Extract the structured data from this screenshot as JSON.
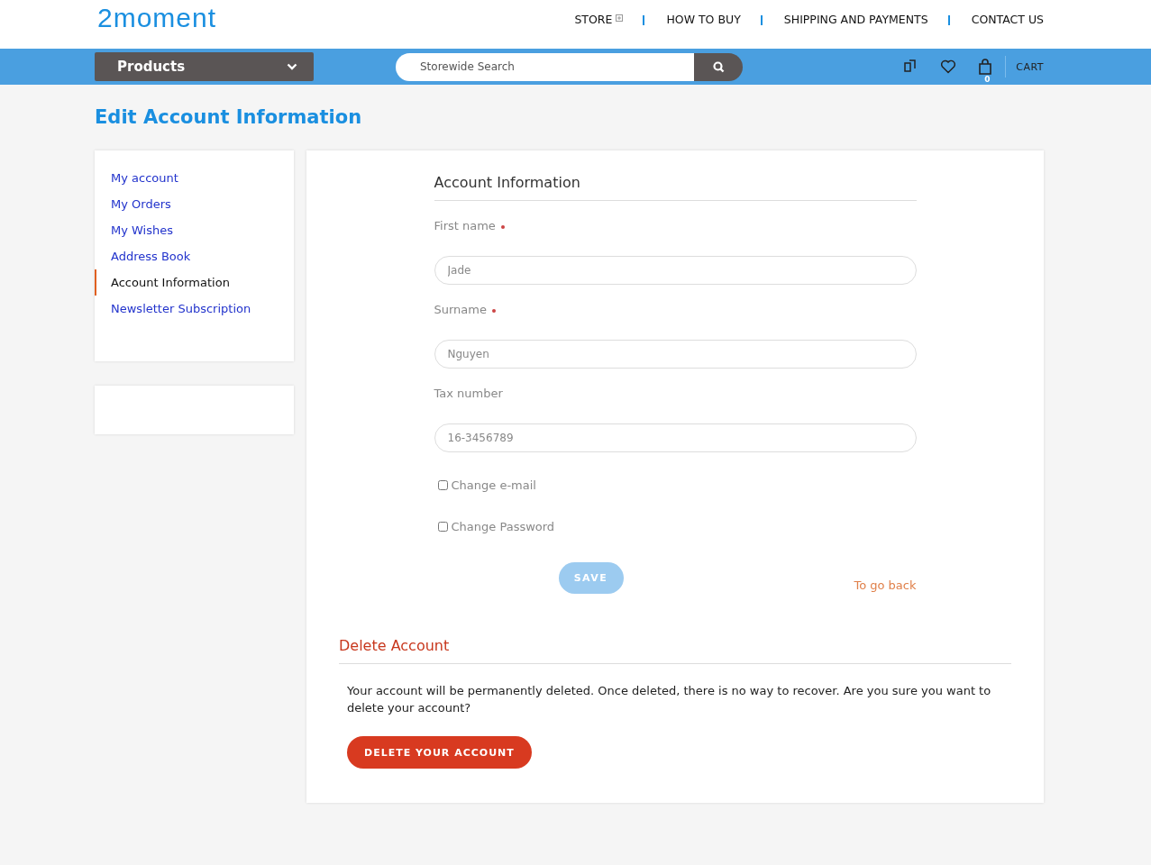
{
  "header": {
    "logo": "2moment",
    "nav": [
      {
        "label": "STORE",
        "has_menu": true
      },
      {
        "label": "HOW TO BUY",
        "has_menu": false
      },
      {
        "label": "SHIPPING AND PAYMENTS",
        "has_menu": false
      },
      {
        "label": "CONTACT US",
        "has_menu": false
      }
    ]
  },
  "toolbar": {
    "products_label": "Products",
    "search": {
      "placeholder": "Storewide Search"
    },
    "cart_count": "0",
    "cart_label": "CART"
  },
  "page_title": "Edit Account Information",
  "sidebar": {
    "items": [
      {
        "label": "My account",
        "selected": false
      },
      {
        "label": "My Orders",
        "selected": false
      },
      {
        "label": "My Wishes",
        "selected": false
      },
      {
        "label": "Address Book",
        "selected": false
      },
      {
        "label": "Account Information",
        "selected": true
      },
      {
        "label": "Newsletter Subscription",
        "selected": false
      }
    ]
  },
  "form": {
    "title": "Account Information",
    "fields": [
      {
        "label": "First name",
        "required": true,
        "value": "Jade"
      },
      {
        "label": "Surname",
        "required": true,
        "value": "Nguyen"
      },
      {
        "label": "Tax number",
        "required": false,
        "value": "16-3456789"
      }
    ],
    "checkboxes": [
      {
        "label": "Change e-mail",
        "checked": false
      },
      {
        "label": "Change Password",
        "checked": false
      }
    ],
    "save": {
      "label": "SAVE",
      "disabled": true
    },
    "back_link": "To go back"
  },
  "delete_section": {
    "title": "Delete Account",
    "message": "Your account will be permanently deleted. Once deleted, there is no way to recover. Are you sure you want to delete your account?",
    "button": "DELETE YOUR ACCOUNT"
  }
}
